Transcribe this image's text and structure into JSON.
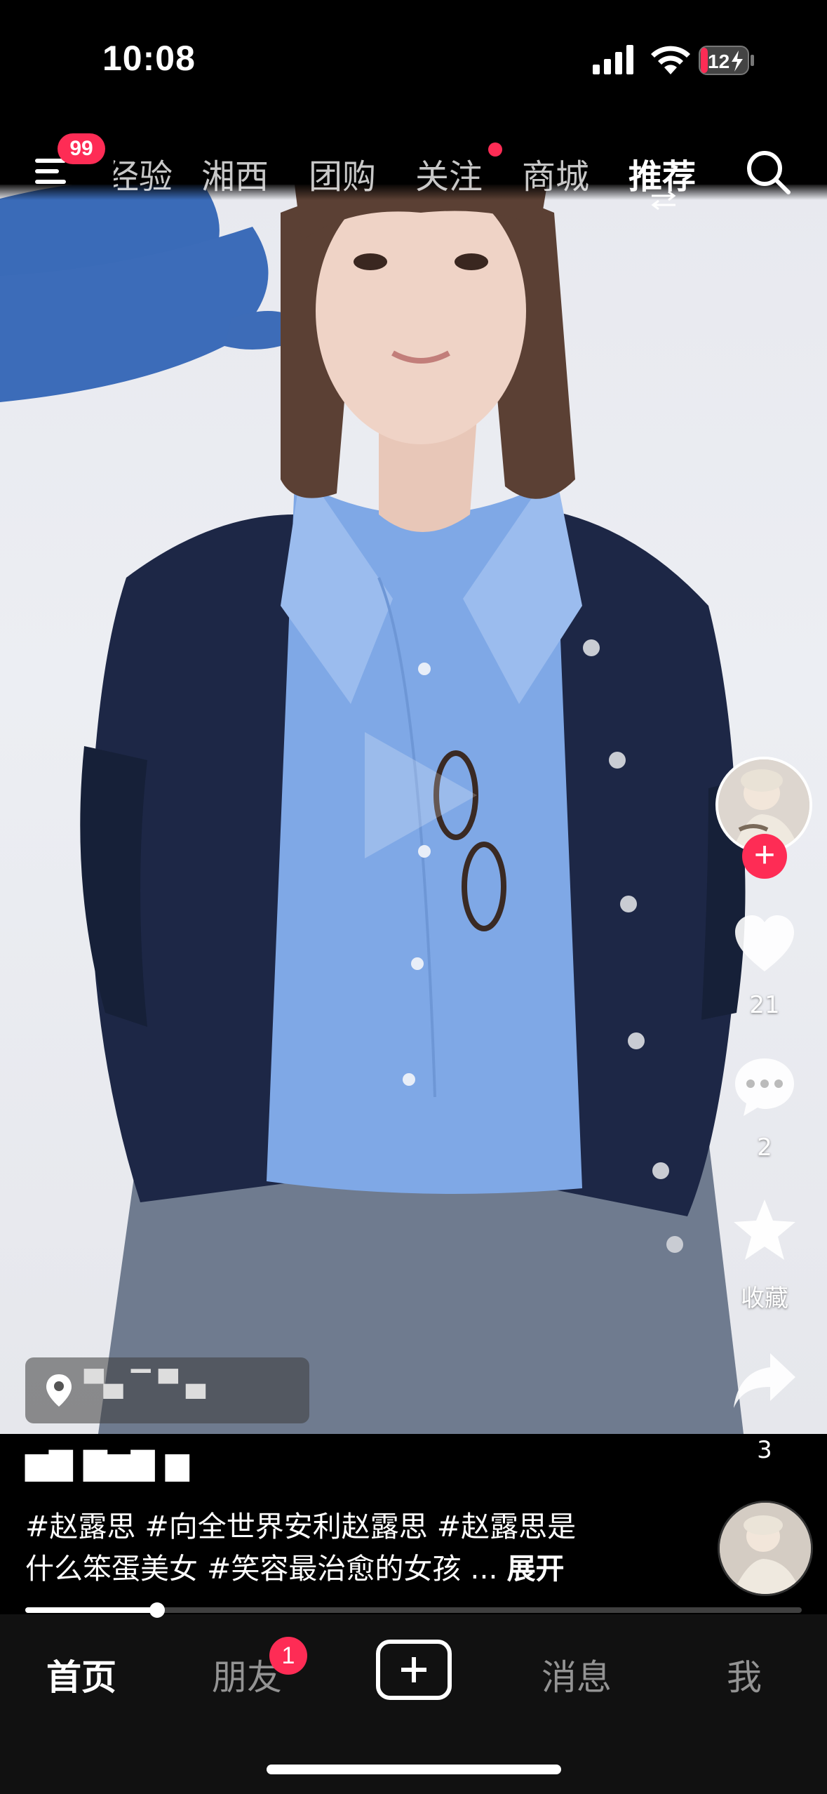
{
  "status_bar": {
    "time": "10:08",
    "battery": "12"
  },
  "top_nav": {
    "badge": "99",
    "tabs": [
      {
        "label": "经验"
      },
      {
        "label": "湘西"
      },
      {
        "label": "团购"
      },
      {
        "label": "关注"
      },
      {
        "label": "商城"
      },
      {
        "label": "推荐"
      }
    ],
    "active_tab": "推荐"
  },
  "right_rail": {
    "likes": "21",
    "comments": "2",
    "favorite_label": "收藏",
    "shares": "3"
  },
  "location": {
    "text": "▀▄ ▔ ▀ ▄"
  },
  "post": {
    "author": "▆▇ ▇▆▇ ▆",
    "caption_line1": "#赵露思 #向全世界安利赵露思 #赵露思是",
    "caption_line2": "什么笨蛋美女 #笑容最治愈的女孩 ...",
    "expand_label": "展开",
    "progress_fraction": 0.17
  },
  "bottom_nav": {
    "items": [
      {
        "label": "首页"
      },
      {
        "label": "朋友"
      },
      {
        "label": "消息"
      },
      {
        "label": "我"
      }
    ],
    "friends_badge": "1"
  },
  "colors": {
    "accent": "#fe2c55",
    "background": "#000000"
  },
  "icons": [
    "menu-icon",
    "search-icon",
    "swap-icon",
    "heart-icon",
    "comment-icon",
    "star-icon",
    "share-icon",
    "location-pin-icon",
    "plus-icon"
  ]
}
